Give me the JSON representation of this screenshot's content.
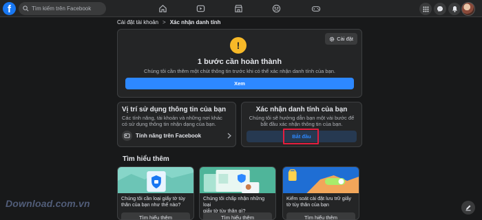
{
  "topbar": {
    "logo_letter": "f",
    "search_placeholder": "Tìm kiếm trên Facebook",
    "nav_icons": [
      "home-icon",
      "watch-icon",
      "marketplace-icon",
      "groups-icon",
      "gaming-icon"
    ],
    "right_icons": [
      "menu-grid-icon",
      "messenger-icon",
      "bell-icon"
    ]
  },
  "breadcrumb": {
    "parent": "Cài đặt tài khoản",
    "separator": ">",
    "current": "Xác nhận danh tính"
  },
  "status": {
    "settings_label": "Cài đặt",
    "warning_symbol": "!",
    "title": "1 bước cần hoàn thành",
    "description": "Chúng tôi cần thêm một chút thông tin trước khi có thể xác nhận danh tính của bạn.",
    "view_button": "Xem"
  },
  "info_card": {
    "title": "Vị trí sử dụng thông tin của bạn",
    "description_lines": [
      "Các tính năng, tài khoản và những nơi khác",
      "có sử dụng thông tin nhận dạng của bạn."
    ],
    "feature_label": "Tính năng trên Facebook"
  },
  "verify_card": {
    "title": "Xác nhận danh tính của bạn",
    "description_lines": [
      "Chúng tôi sẽ hướng dẫn bạn một vài bước để",
      "bắt đầu xác nhận thông tin của bạn."
    ],
    "start_button": "Bắt đầu"
  },
  "learn_more": {
    "title": "Tìm hiểu thêm",
    "cards": [
      {
        "text_lines": [
          "Chúng tôi cần loại giấy tờ tùy",
          "thân của bạn như thế nào?"
        ],
        "button": "Tìm hiểu thêm"
      },
      {
        "text_lines": [
          "Chúng tôi chấp nhận những loại",
          "giấy tờ tùy thân gì?"
        ],
        "button": "Tìm hiểu thêm"
      },
      {
        "text_lines": [
          "Kiểm soát cài đặt lưu trữ giấy",
          "tờ tùy thân của bạn"
        ],
        "button": "Tìm hiểu thêm"
      }
    ]
  },
  "watermark": "Download.com.vn",
  "colors": {
    "background": "#18191a",
    "card": "#242526",
    "accent": "#2d88ff",
    "warning": "#f7b928",
    "highlight": "#e41e3f"
  }
}
